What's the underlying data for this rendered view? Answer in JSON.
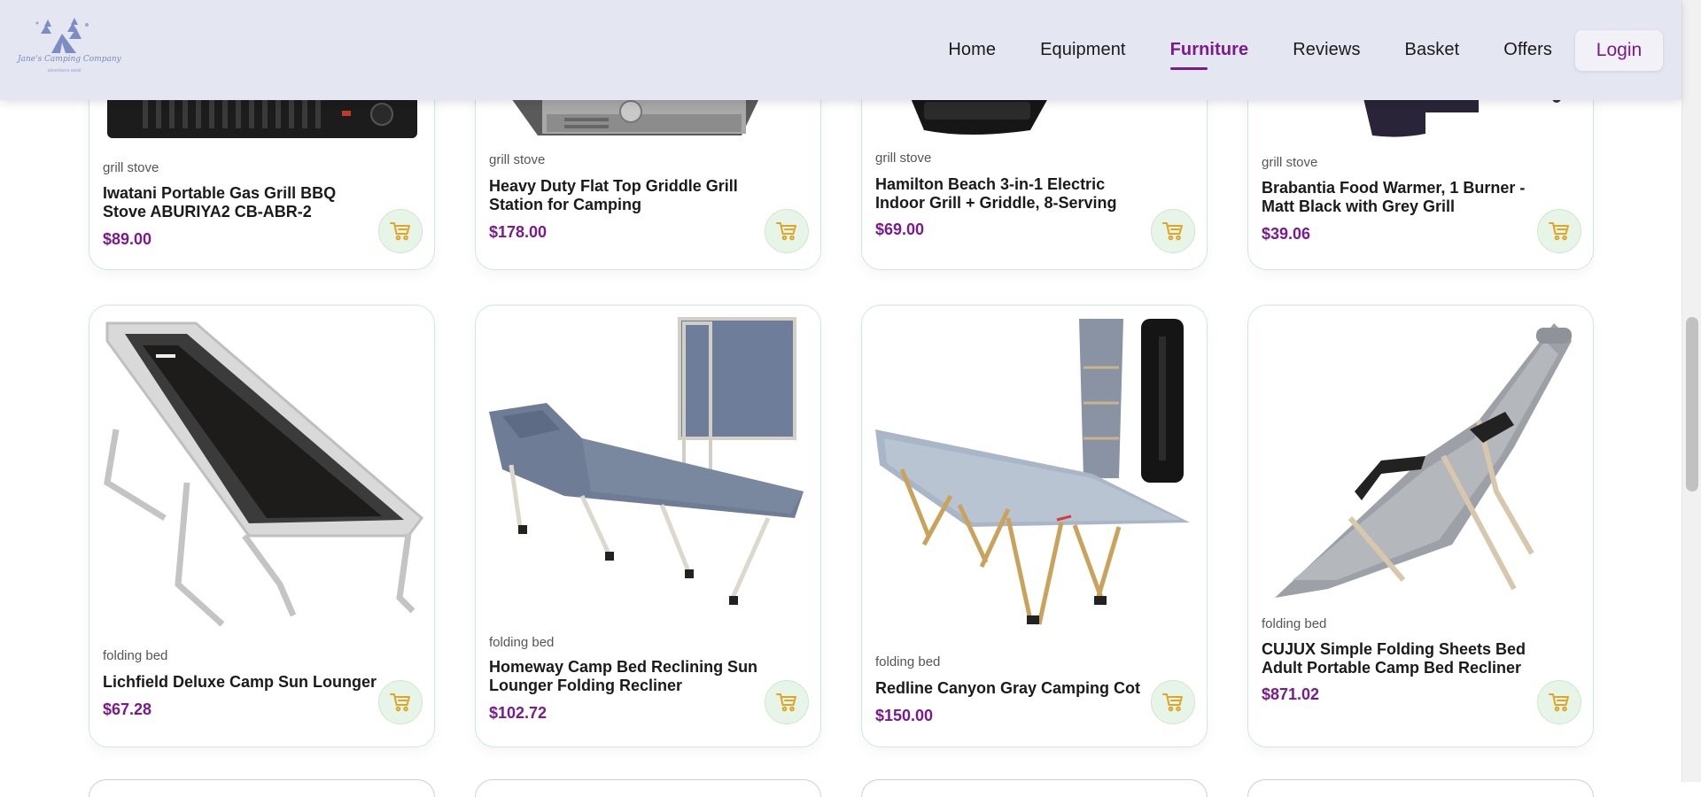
{
  "header": {
    "logo_text": "Jane's Camping Company",
    "logo_subtext": "adventures await",
    "nav": [
      {
        "label": "Home",
        "active": false
      },
      {
        "label": "Equipment",
        "active": false
      },
      {
        "label": "Furniture",
        "active": true
      },
      {
        "label": "Reviews",
        "active": false
      },
      {
        "label": "Basket",
        "active": false
      },
      {
        "label": "Offers",
        "active": false
      }
    ],
    "login_label": "Login"
  },
  "colors": {
    "accent": "#7a1a8c",
    "header_bg": "#e4e6f2",
    "cart_bg": "#e6f5e7",
    "cart_icon": "#e0a527",
    "card_border": "#cfe8df"
  },
  "products": {
    "row1": [
      {
        "category": "grill stove",
        "title": "Iwatani Portable Gas Grill BBQ Stove ABURIYA2 CB-ABR-2",
        "price": "$89.00",
        "image_icon": "grill-stove-image"
      },
      {
        "category": "grill stove",
        "title": "Heavy Duty Flat Top Griddle Grill Station for Camping",
        "price": "$178.00",
        "image_icon": "griddle-image"
      },
      {
        "category": "grill stove",
        "title": "Hamilton Beach 3-in-1 Electric Indoor Grill + Griddle, 8-Serving",
        "price": "$69.00",
        "image_icon": "electric-grill-image"
      },
      {
        "category": "grill stove",
        "title": "Brabantia Food Warmer, 1 Burner - Matt Black with Grey Grill",
        "price": "$39.06",
        "image_icon": "food-warmer-image"
      }
    ],
    "row2": [
      {
        "category": "folding bed",
        "title": "Lichfield Deluxe Camp Sun Lounger",
        "price": "$67.28",
        "image_icon": "sun-lounger-image"
      },
      {
        "category": "folding bed",
        "title": "Homeway Camp Bed Reclining Sun Lounger Folding Recliner",
        "price": "$102.72",
        "image_icon": "reclining-camp-bed-image"
      },
      {
        "category": "folding bed",
        "title": "Redline Canyon Gray Camping Cot",
        "price": "$150.00",
        "image_icon": "camping-cot-image"
      },
      {
        "category": "folding bed",
        "title": "CUJUX Simple Folding Sheets Bed Adult Portable Camp Bed Recliner",
        "price": "$871.02",
        "image_icon": "folding-recliner-image"
      }
    ]
  }
}
